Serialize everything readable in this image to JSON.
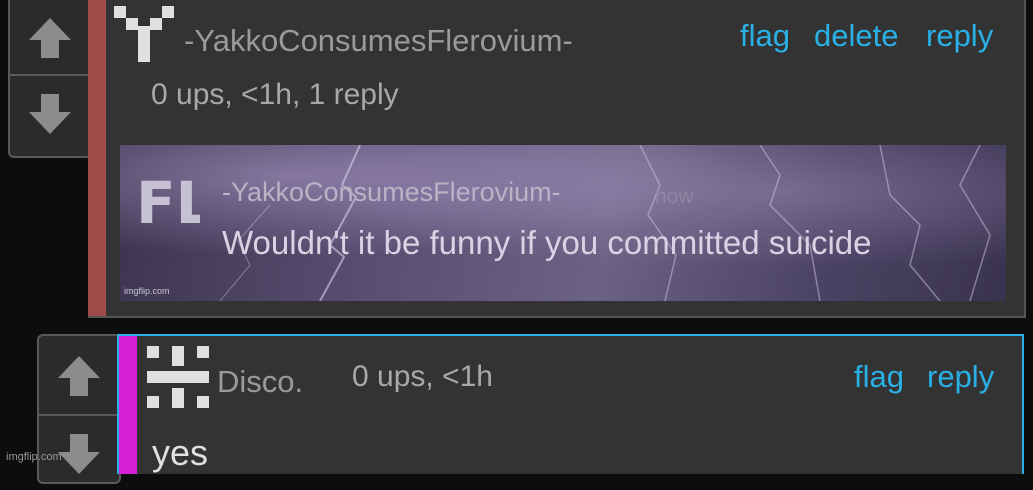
{
  "comment1": {
    "username": "-YakkoConsumesFlerovium-",
    "meta": "0 ups, <1h, 1 reply",
    "actions": {
      "flag": "flag",
      "delete": "delete",
      "reply": "reply"
    },
    "meme": {
      "logo_text": "FL",
      "username": "-YakkoConsumesFlerovium-",
      "time": "now",
      "text": "Wouldn't it be funny if you committed suicide",
      "watermark": "imgflip.com"
    }
  },
  "comment2": {
    "username": "Disco.",
    "meta": "0 ups, <1h",
    "actions": {
      "flag": "flag",
      "reply": "reply"
    },
    "text": "yes"
  },
  "watermark": "imgflip.com",
  "icons": {
    "upvote": "arrow-up-icon",
    "downvote": "arrow-down-icon",
    "avatar1": "y-avatar-icon",
    "avatar2": "pixel-avatar-icon"
  },
  "colors": {
    "link": "#29b1e6",
    "comment1_accent": "#a04a4a",
    "comment2_accent": "#d81fd8",
    "comment2_border": "#29b1e6"
  }
}
